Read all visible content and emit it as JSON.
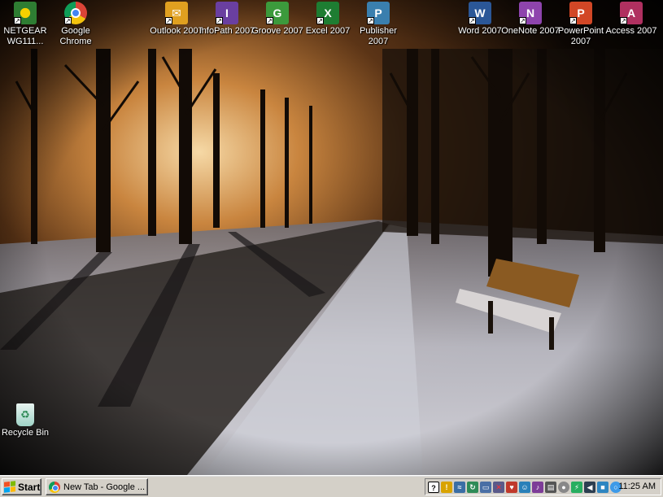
{
  "desktop": {
    "icons": [
      {
        "label": "NETGEAR WG111...",
        "icon": "netgear-wireless-icon",
        "color": "#2e7d32"
      },
      {
        "label": "Google Chrome",
        "icon": "chrome-icon",
        "color": "#db4437"
      },
      {
        "label": "Outlook 2007",
        "icon": "outlook-icon",
        "color": "#e0a020"
      },
      {
        "label": "InfoPath 2007",
        "icon": "infopath-icon",
        "color": "#6a3fa0"
      },
      {
        "label": "Groove 2007",
        "icon": "groove-icon",
        "color": "#3c9a3c"
      },
      {
        "label": "Excel 2007",
        "icon": "excel-icon",
        "color": "#1e7d32"
      },
      {
        "label": "Publisher 2007",
        "icon": "publisher-icon",
        "color": "#3a7fae"
      },
      {
        "label": "Word 2007",
        "icon": "word-icon",
        "color": "#2b5797"
      },
      {
        "label": "OneNote 2007",
        "icon": "onenote-icon",
        "color": "#8e44ad"
      },
      {
        "label": "PowerPoint 2007",
        "icon": "powerpoint-icon",
        "color": "#d24726"
      },
      {
        "label": "Access 2007",
        "icon": "access-icon",
        "color": "#b03060"
      },
      {
        "label": "Recycle Bin",
        "icon": "recycle-bin-icon",
        "color": "#9fd3c7"
      }
    ]
  },
  "taskbar": {
    "start_label": "Start",
    "task_label": "New Tab - Google ...",
    "clock": "11:25 AM",
    "tray_icons": [
      {
        "icon": "help-icon",
        "color": "#1a1a1a"
      },
      {
        "icon": "shield-icon",
        "color": "#d9a300"
      },
      {
        "icon": "network-icon",
        "color": "#3a6ea5"
      },
      {
        "icon": "sync-icon",
        "color": "#2e8b57"
      },
      {
        "icon": "display-icon",
        "color": "#4a6fa5"
      },
      {
        "icon": "network-disconnected-icon",
        "color": "#5a5a8a"
      },
      {
        "icon": "mail-icon",
        "color": "#c0392b"
      },
      {
        "icon": "messenger-icon",
        "color": "#2980b9"
      },
      {
        "icon": "media-icon",
        "color": "#7d3c98"
      },
      {
        "icon": "printer-icon",
        "color": "#555555"
      },
      {
        "icon": "disc-icon",
        "color": "#888888"
      },
      {
        "icon": "usb-icon",
        "color": "#27ae60"
      },
      {
        "icon": "volume-icon",
        "color": "#2c3e50"
      },
      {
        "icon": "security-icon",
        "color": "#2e86c1"
      },
      {
        "icon": "chrome-tray-icon",
        "color": "#3d9ae8"
      }
    ]
  }
}
